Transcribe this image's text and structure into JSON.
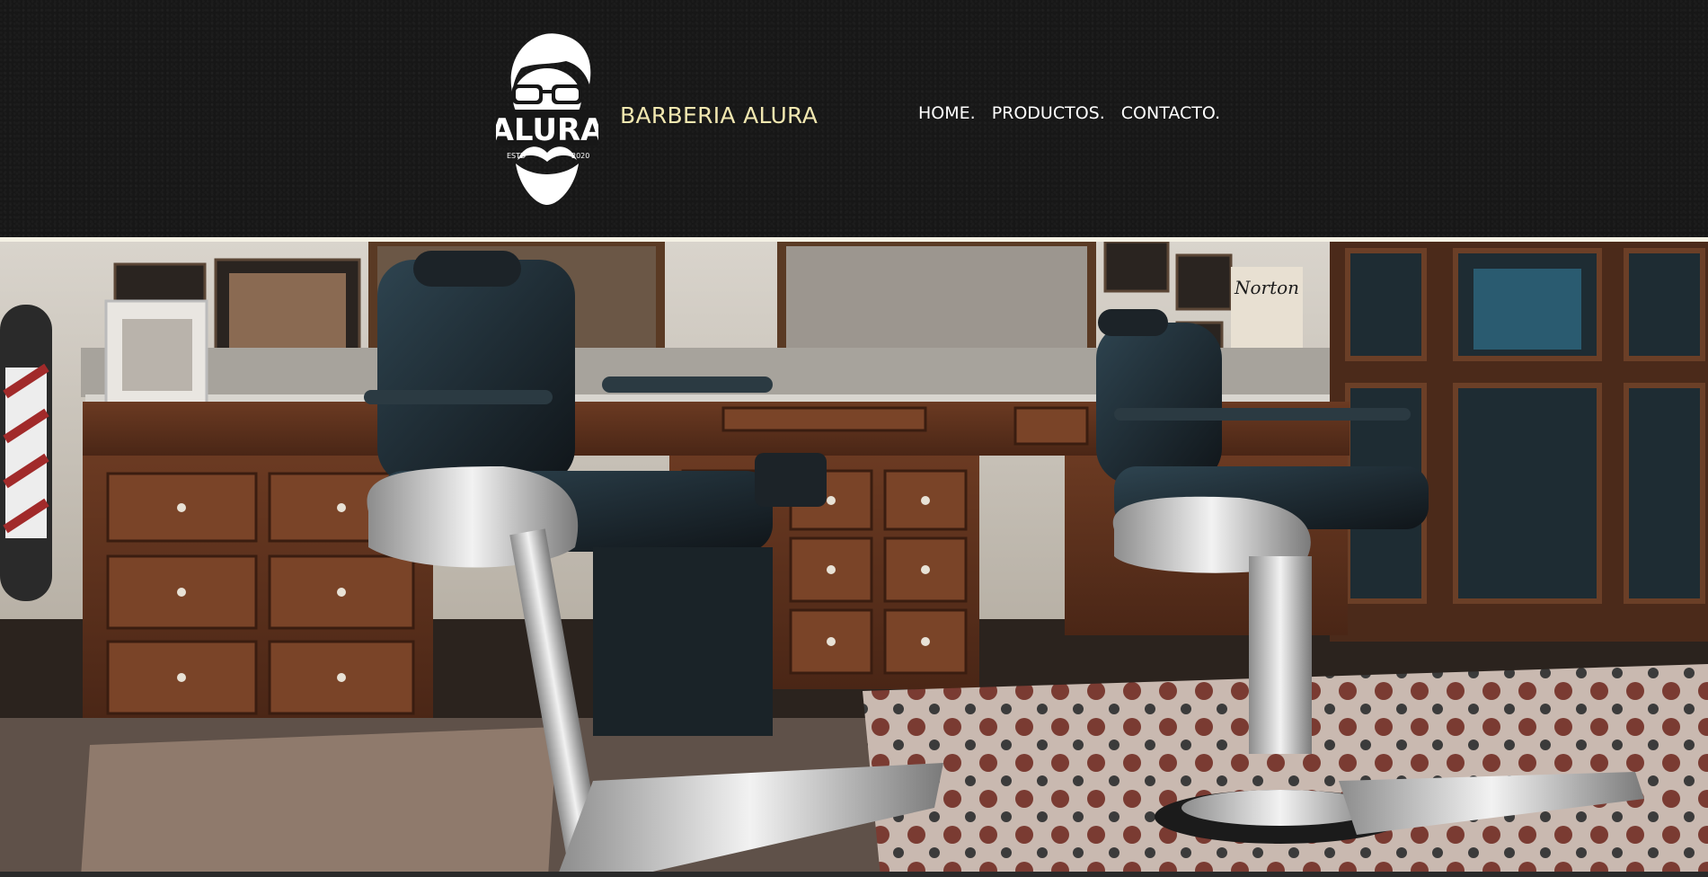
{
  "header": {
    "logo_text": "ALURA",
    "logo_est_left": "ESTD",
    "logo_est_right": "2020",
    "brand_name": "BARBERIA ALURA"
  },
  "nav": {
    "items": [
      {
        "label": "HOME."
      },
      {
        "label": "PRODUCTOS."
      },
      {
        "label": "CONTACTO."
      }
    ]
  },
  "hero": {
    "icon": "barbershop-interior-photo",
    "poster_text": "Norton"
  },
  "colors": {
    "header_bg": "#171717",
    "brand": "#f1e7b0",
    "nav_text": "#ffffff",
    "divider": "#f4f1e4"
  }
}
